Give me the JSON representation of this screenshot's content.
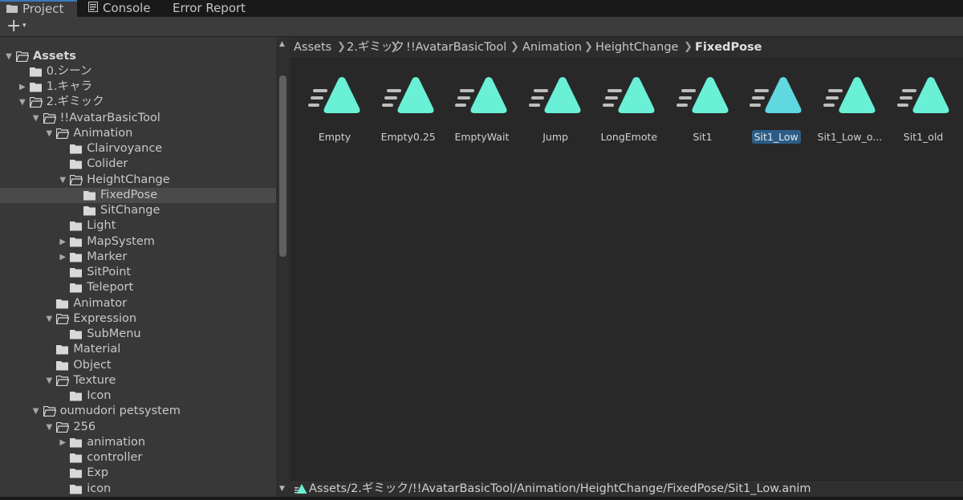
{
  "tabs": [
    {
      "label": "Project",
      "icon": "folder-icon",
      "active": true
    },
    {
      "label": "Console",
      "icon": "console-icon",
      "active": false
    },
    {
      "label": "Error Report",
      "icon": "",
      "active": false
    }
  ],
  "toolbar": {
    "add_label": "+",
    "add_caret": "▾"
  },
  "tree": [
    {
      "label": "Assets",
      "arrow": "open",
      "folder": "open",
      "bold": true
    },
    {
      "label": "0.シーン",
      "arrow": "none",
      "folder": "closed"
    },
    {
      "label": "1.キャラ",
      "arrow": "closed",
      "folder": "closed"
    },
    {
      "label": "2.ギミック",
      "arrow": "open",
      "folder": "open"
    },
    {
      "label": "!!AvatarBasicTool",
      "arrow": "open",
      "folder": "open"
    },
    {
      "label": "Animation",
      "arrow": "open",
      "folder": "open"
    },
    {
      "label": "Clairvoyance",
      "arrow": "none",
      "folder": "closed"
    },
    {
      "label": "Colider",
      "arrow": "none",
      "folder": "closed"
    },
    {
      "label": "HeightChange",
      "arrow": "open",
      "folder": "open"
    },
    {
      "label": "FixedPose",
      "arrow": "none",
      "folder": "closed",
      "selected": true
    },
    {
      "label": "SitChange",
      "arrow": "none",
      "folder": "closed"
    },
    {
      "label": "Light",
      "arrow": "none",
      "folder": "closed"
    },
    {
      "label": "MapSystem",
      "arrow": "closed",
      "folder": "closed"
    },
    {
      "label": "Marker",
      "arrow": "closed",
      "folder": "closed"
    },
    {
      "label": "SitPoint",
      "arrow": "none",
      "folder": "closed"
    },
    {
      "label": "Teleport",
      "arrow": "none",
      "folder": "closed"
    },
    {
      "label": "Animator",
      "arrow": "none",
      "folder": "closed"
    },
    {
      "label": "Expression",
      "arrow": "open",
      "folder": "open"
    },
    {
      "label": "SubMenu",
      "arrow": "none",
      "folder": "closed"
    },
    {
      "label": "Material",
      "arrow": "none",
      "folder": "closed"
    },
    {
      "label": "Object",
      "arrow": "none",
      "folder": "closed"
    },
    {
      "label": "Texture",
      "arrow": "open",
      "folder": "open"
    },
    {
      "label": "Icon",
      "arrow": "none",
      "folder": "closed"
    },
    {
      "label": "oumudori petsystem",
      "arrow": "open",
      "folder": "open"
    },
    {
      "label": "256",
      "arrow": "open",
      "folder": "open"
    },
    {
      "label": "animation",
      "arrow": "closed",
      "folder": "closed"
    },
    {
      "label": "controller",
      "arrow": "none",
      "folder": "closed"
    },
    {
      "label": "Exp",
      "arrow": "none",
      "folder": "closed"
    },
    {
      "label": "icon",
      "arrow": "none",
      "folder": "closed"
    }
  ],
  "breadcrumb": [
    "Assets",
    "2.ギミック",
    "!!AvatarBasicTool",
    "Animation",
    "HeightChange",
    "FixedPose"
  ],
  "breadcrumb_sep": "❯",
  "assets": [
    {
      "name": "Empty"
    },
    {
      "name": "Empty0.25"
    },
    {
      "name": "EmptyWait"
    },
    {
      "name": "Jump"
    },
    {
      "name": "LongEmote"
    },
    {
      "name": "Sit1"
    },
    {
      "name": "Sit1_Low",
      "selected": true
    },
    {
      "name": "Sit1_Low_o..."
    },
    {
      "name": "Sit1_old"
    }
  ],
  "status_path": "Assets/2.ギミック/!!AvatarBasicTool/Animation/HeightChange/FixedPose/Sit1_Low.anim",
  "colors": {
    "accent": "#3a79bb",
    "anim_icon": "#69f0d6",
    "anim_icon_selected": "#5fd8e0",
    "selection": "#2c5d87"
  }
}
